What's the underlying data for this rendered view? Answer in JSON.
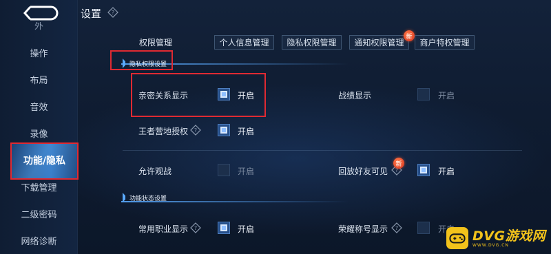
{
  "header": {
    "title": "设置"
  },
  "sidebar": {
    "items": [
      {
        "label": "外"
      },
      {
        "label": "操作"
      },
      {
        "label": "布局"
      },
      {
        "label": "音效"
      },
      {
        "label": "录像"
      },
      {
        "label": "功能/隐私"
      },
      {
        "label": "下载管理"
      },
      {
        "label": "二级密码"
      },
      {
        "label": "网络诊断"
      }
    ],
    "active_index": 5
  },
  "permissions": {
    "label": "权限管理",
    "buttons": [
      {
        "label": "个人信息管理"
      },
      {
        "label": "隐私权限管理"
      },
      {
        "label": "通知权限管理",
        "badge": "新"
      },
      {
        "label": "商户特权管理"
      }
    ]
  },
  "sections": {
    "privacy_title": "隐私权限设置",
    "feature_title": "功能状态设置"
  },
  "settings": {
    "intimacy": {
      "label": "亲密关系显示",
      "state_label": "开启",
      "enabled": true
    },
    "record": {
      "label": "战绩显示",
      "state_label": "开启",
      "enabled": false
    },
    "camp": {
      "label": "王者营地授权",
      "state_label": "开启",
      "enabled": true
    },
    "spectate": {
      "label": "允许观战",
      "state_label": "开启",
      "enabled": false
    },
    "replay": {
      "label": "回放好友可见",
      "state_label": "开启",
      "enabled": true,
      "badge": "新"
    },
    "position": {
      "label": "常用职业显示",
      "state_label": "开启",
      "enabled": true
    },
    "honor": {
      "label": "荣耀称号显示",
      "state_label": "开启",
      "enabled": false
    }
  },
  "watermark": {
    "main": "DVG游戏网",
    "sub": "WWW.DVG.CN"
  },
  "colors": {
    "accent": "#5aa9ff",
    "highlight_box": "#e02a32",
    "logo": "#f2c21b"
  }
}
